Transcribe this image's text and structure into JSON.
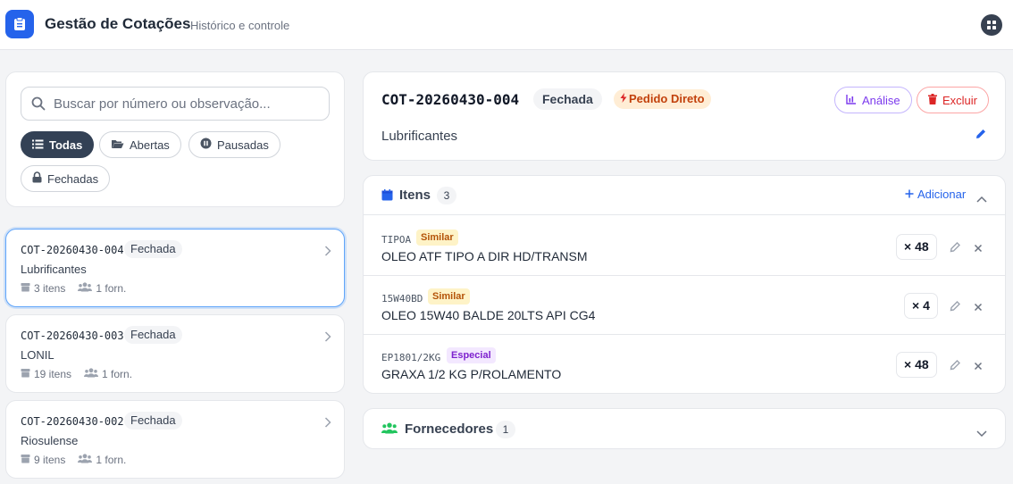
{
  "header": {
    "title": "Gestão de Cotações",
    "subtitle": "Histórico e controle"
  },
  "search": {
    "placeholder": "Buscar por número ou observação..."
  },
  "filters": [
    {
      "label": "Todas",
      "icon": "list-icon",
      "active": true
    },
    {
      "label": "Abertas",
      "icon": "folder-open-icon",
      "active": false
    },
    {
      "label": "Pausadas",
      "icon": "pause-circle-icon",
      "active": false
    },
    {
      "label": "Fechadas",
      "icon": "lock-icon",
      "active": false
    }
  ],
  "quotations": [
    {
      "code": "COT-20260430-004",
      "status": "Fechada",
      "title": "Lubrificantes",
      "items": "3 itens",
      "suppliers": "1 forn."
    },
    {
      "code": "COT-20260430-003",
      "status": "Fechada",
      "title": "LONIL",
      "items": "19 itens",
      "suppliers": "1 forn."
    },
    {
      "code": "COT-20260430-002",
      "status": "Fechada",
      "title": "Riosulense",
      "items": "9 itens",
      "suppliers": "1 forn."
    }
  ],
  "detail": {
    "code": "COT-20260430-004",
    "status": "Fechada",
    "badge": "Pedido Direto",
    "analise_label": "Análise",
    "excluir_label": "Excluir",
    "description": "Lubrificantes"
  },
  "items_panel": {
    "title": "Itens",
    "count": "3",
    "add_label": "Adicionar",
    "rows": [
      {
        "code": "TIPOA",
        "tag": "Similar",
        "name": "OLEO ATF TIPO A DIR HD/TRANSM",
        "qty": "× 48"
      },
      {
        "code": "15W40BD",
        "tag": "Similar",
        "name": "OLEO 15W40 BALDE 20LTS API CG4",
        "qty": "× 4"
      },
      {
        "code": "EP1801/2KG",
        "tag": "Especial",
        "name": "GRAXA 1/2 KG P/ROLAMENTO",
        "qty": "× 48"
      }
    ]
  },
  "suppliers_panel": {
    "title": "Fornecedores",
    "count": "1"
  },
  "colors": {
    "primary": "#2563eb",
    "dark_chip": "#334155",
    "orange_badge": "#c2410c",
    "purple": "#7c3aed",
    "red": "#dc2626",
    "green_icon": "#22c55e"
  }
}
